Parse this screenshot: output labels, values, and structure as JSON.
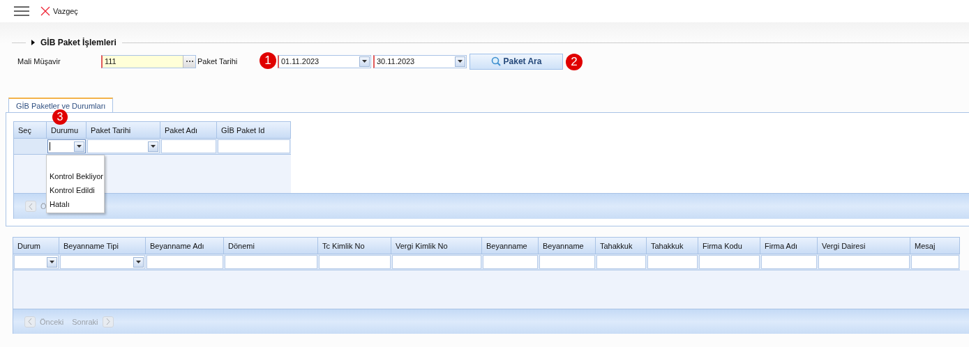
{
  "toolbar": {
    "cancel_label": "Vazgeç"
  },
  "section": {
    "title": "GİB Paket İşlemleri"
  },
  "filters": {
    "advisor_label": "Mali Müşavir",
    "advisor_value": "111",
    "date_label": "Paket Tarihi",
    "date_from": "01.11.2023",
    "date_to": "30.11.2023",
    "search_button": "Paket Ara"
  },
  "callouts": {
    "date": "1",
    "search": "2",
    "status": "3"
  },
  "tabs": [
    {
      "label": "GİB Paketler ve Durumları",
      "selected": true
    }
  ],
  "packages_grid": {
    "columns": [
      {
        "label": "Seç",
        "kind": "none",
        "focused": false
      },
      {
        "label": "Durumu",
        "kind": "combo",
        "focused": true
      },
      {
        "label": "Paket Tarihi",
        "kind": "combo",
        "focused": false
      },
      {
        "label": "Paket Adı",
        "kind": "text",
        "focused": false
      },
      {
        "label": "GİB Paket Id",
        "kind": "text",
        "focused": false
      }
    ],
    "pager": {
      "prev": "Ö",
      "disabled": true
    }
  },
  "status_menu": {
    "items": [
      "Kontrol Bekliyor",
      "Kontrol Edildi",
      "Hatalı"
    ]
  },
  "declarations_grid": {
    "columns": [
      {
        "label": "Durum",
        "kind": "combo"
      },
      {
        "label": "Beyanname Tipi",
        "kind": "combo"
      },
      {
        "label": "Beyanname Adı",
        "kind": "text"
      },
      {
        "label": "Dönemi",
        "kind": "text"
      },
      {
        "label": "Tc Kimlik No",
        "kind": "text"
      },
      {
        "label": "Vergi Kimlik No",
        "kind": "text"
      },
      {
        "label": "Beyanname",
        "kind": "text"
      },
      {
        "label": "Beyanname",
        "kind": "text"
      },
      {
        "label": "Tahakkuk",
        "kind": "text"
      },
      {
        "label": "Tahakkuk",
        "kind": "text"
      },
      {
        "label": "Firma Kodu",
        "kind": "text"
      },
      {
        "label": "Firma Adı",
        "kind": "text"
      },
      {
        "label": "Vergi Dairesi",
        "kind": "text"
      },
      {
        "label": "Mesaj",
        "kind": "text"
      }
    ],
    "pager": {
      "prev": "Önceki",
      "next": "Sonraki",
      "disabled": true
    }
  }
}
